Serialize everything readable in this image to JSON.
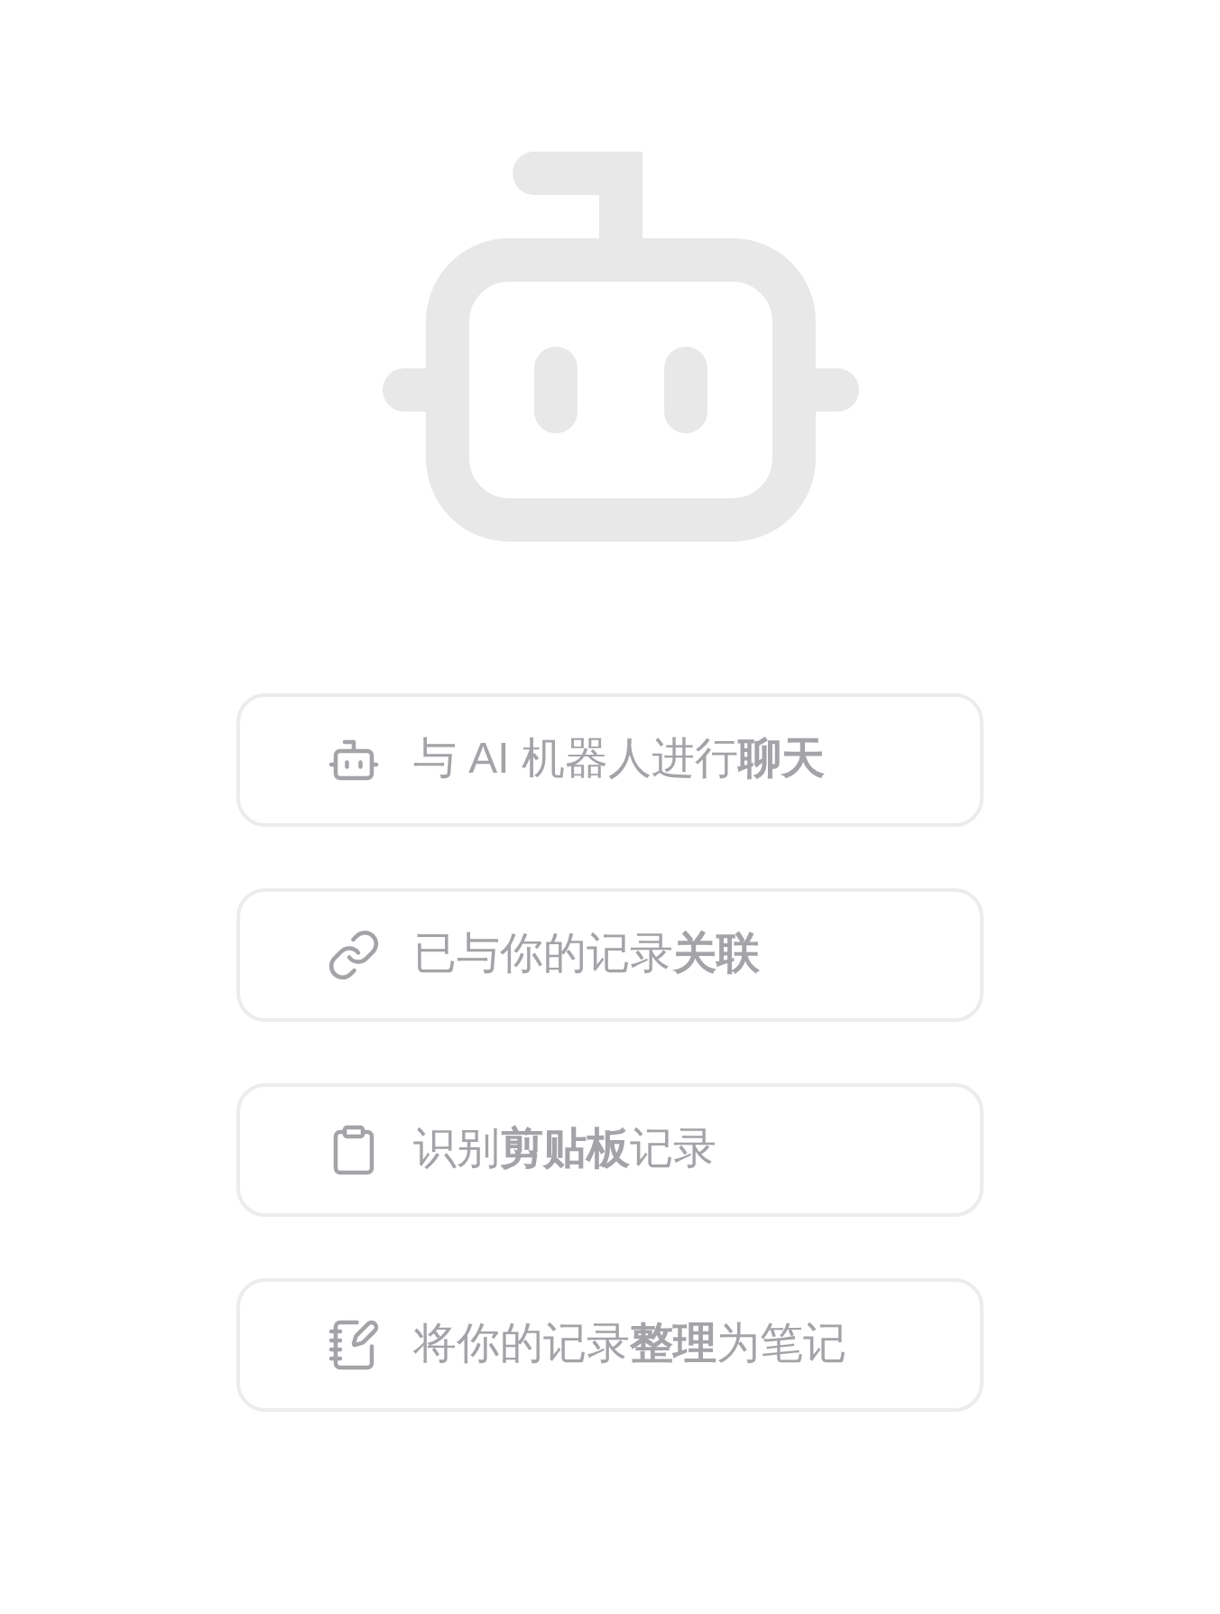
{
  "actions": [
    {
      "kind": "robot",
      "label": "与 AI 机器人进行**聊天**"
    },
    {
      "kind": "link",
      "label": "已与你的记录**关联**"
    },
    {
      "kind": "clipboard",
      "label": "识别**剪贴板**记录"
    },
    {
      "kind": "notebook",
      "label": "将你的记录**整理**为笔记"
    }
  ]
}
